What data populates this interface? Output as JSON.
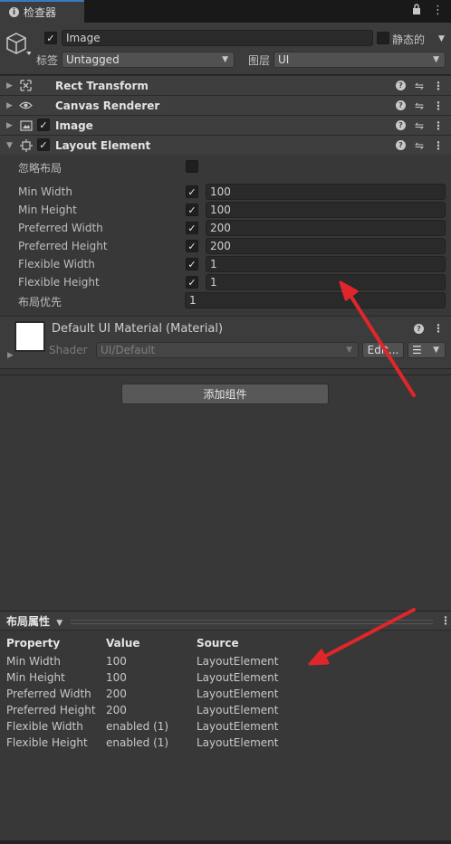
{
  "tab": {
    "title": "检查器",
    "lock_icon": "lock-icon",
    "menu_icon": "kebab-menu-icon"
  },
  "object": {
    "active": true,
    "name": "Image",
    "static_label": "静态的",
    "tag_label": "标签",
    "tag_value": "Untagged",
    "layer_label": "图层",
    "layer_value": "UI"
  },
  "components": [
    {
      "title": "Rect Transform",
      "icon": "rect-transform-icon"
    },
    {
      "title": "Canvas Renderer",
      "icon": "eye-icon"
    },
    {
      "title": "Image",
      "icon": "image-icon"
    },
    {
      "title": "Layout Element",
      "icon": "layout-element-icon"
    }
  ],
  "layout_element": {
    "ignore_layout_label": "忽略布局",
    "rows": [
      {
        "label": "Min Width",
        "value": "100"
      },
      {
        "label": "Min Height",
        "value": "100"
      },
      {
        "label": "Preferred Width",
        "value": "200"
      },
      {
        "label": "Preferred Height",
        "value": "200"
      },
      {
        "label": "Flexible Width",
        "value": "1"
      },
      {
        "label": "Flexible Height",
        "value": "1"
      }
    ],
    "priority_label": "布局优先",
    "priority_value": "1"
  },
  "material": {
    "title": "Default UI Material (Material)",
    "shader_label": "Shader",
    "shader_value": "UI/Default",
    "edit_label": "Edit..."
  },
  "add_component_label": "添加组件",
  "layout_properties": {
    "title": "布局属性",
    "headers": [
      "Property",
      "Value",
      "Source"
    ],
    "rows": [
      [
        "Min Width",
        "100",
        "LayoutElement"
      ],
      [
        "Min Height",
        "100",
        "LayoutElement"
      ],
      [
        "Preferred Width",
        "200",
        "LayoutElement"
      ],
      [
        "Preferred Height",
        "200",
        "LayoutElement"
      ],
      [
        "Flexible Width",
        "enabled (1)",
        "LayoutElement"
      ],
      [
        "Flexible Height",
        "enabled (1)",
        "LayoutElement"
      ]
    ]
  },
  "colors": {
    "accent": "#3a79bb",
    "annotation_arrow": "#e0262a"
  }
}
